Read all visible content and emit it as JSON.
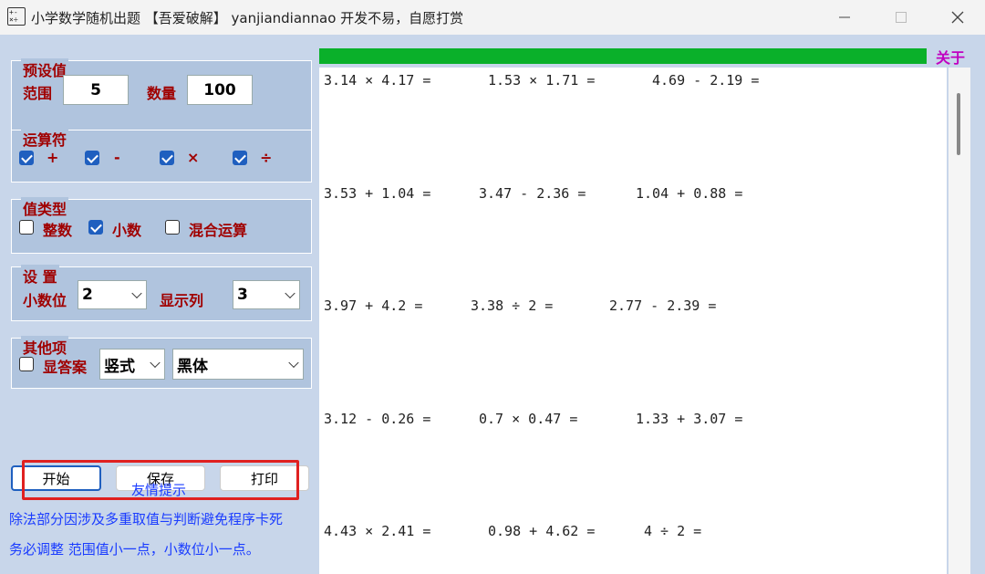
{
  "window": {
    "title": "小学数学随机出题 【吾爱破解】 yanjiandiannao 开发不易，自愿打赏",
    "minimize_icon": "minimize-icon",
    "maximize_icon": "maximize-icon",
    "close_icon": "close-icon",
    "app_icon_glyph": "+-\n×÷"
  },
  "presets": {
    "title": "预设值",
    "range_label": "范围",
    "range_value": "5",
    "count_label": "数量",
    "count_value": "100"
  },
  "operators": {
    "title": "运算符",
    "items": [
      {
        "label": "+",
        "checked": true
      },
      {
        "label": "-",
        "checked": true
      },
      {
        "label": "×",
        "checked": true
      },
      {
        "label": "÷",
        "checked": true
      }
    ]
  },
  "value_type": {
    "title": "值类型",
    "items": [
      {
        "label": "整数",
        "checked": false
      },
      {
        "label": "小数",
        "checked": true
      },
      {
        "label": "混合运算",
        "checked": false
      }
    ]
  },
  "settings": {
    "title": "设 置",
    "decimal_label": "小数位",
    "decimal_value": "2",
    "columns_label": "显示列",
    "columns_value": "3"
  },
  "other": {
    "title": "其他项",
    "show_answer_label": "显答案",
    "show_answer_checked": false,
    "format_value": "竖式",
    "font_value": "黑体"
  },
  "buttons": {
    "start": "开始",
    "save": "保存",
    "print": "打印"
  },
  "tips": {
    "title": "友情提示",
    "line1": "除法部分因涉及多重取值与判断避免程序卡死",
    "line2": "务必调整 范围值小一点，小数位小一点。"
  },
  "progress": {
    "value": 1.0,
    "color": "#0ab02a"
  },
  "about_label": "关于",
  "problems": [
    [
      "3.14 × 4.17 =",
      "1.53 × 1.71 =",
      "4.69 - 2.19 ="
    ],
    [
      "3.53 + 1.04 =",
      "3.47 - 2.36 =",
      "1.04 + 0.88 ="
    ],
    [
      "3.97 + 4.2 =",
      "3.38 ÷ 2 =",
      "2.77 - 2.39 ="
    ],
    [
      "3.12 - 0.26 =",
      "0.7 × 0.47 =",
      "1.33 + 3.07 ="
    ],
    [
      "4.43 × 2.41 =",
      "0.98 + 4.62 =",
      "4 ÷ 2 ="
    ]
  ]
}
